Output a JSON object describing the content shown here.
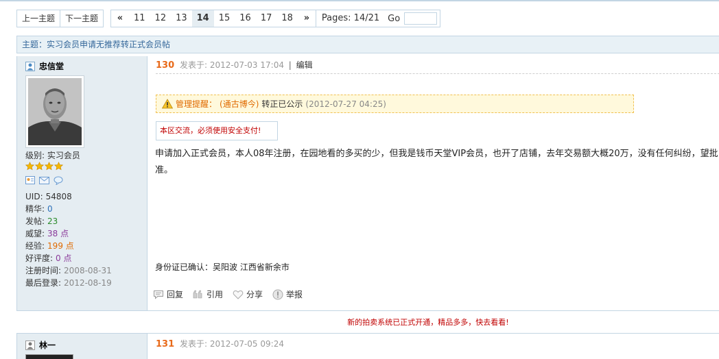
{
  "nav": {
    "prev_topic": "上一主题",
    "next_topic": "下一主题"
  },
  "pager": {
    "prev": "«",
    "pages": [
      "11",
      "12",
      "13",
      "14",
      "15",
      "16",
      "17",
      "18"
    ],
    "current": "14",
    "next": "»",
    "info": "Pages: 14/21",
    "go_label": "Go",
    "go_value": ""
  },
  "topic": {
    "title": "主题：实习会员申请无推荐转正式会员帖"
  },
  "post": {
    "author": "忠信堂",
    "level": "级别: 实习会员",
    "stars": 4,
    "stats": [
      {
        "label": "UID:",
        "value": "54808",
        "color": "#333333"
      },
      {
        "label": "精华:",
        "value": "0",
        "color": "#2b6fb8"
      },
      {
        "label": "发帖:",
        "value": "23",
        "color": "#2a8a2a"
      },
      {
        "label": "威望:",
        "value": "38 点",
        "color": "#8a3a9a"
      },
      {
        "label": "经验:",
        "value": "199 点",
        "color": "#e06a00"
      },
      {
        "label": "好评度:",
        "value": "0 点",
        "color": "#8a3a9a"
      },
      {
        "label": "注册时间:",
        "value": "2008-08-31",
        "color": "#888888"
      },
      {
        "label": "最后登录:",
        "value": "2012-08-19",
        "color": "#888888"
      }
    ],
    "floor": "130",
    "posted_label": "发表于: 2012-07-03 17:04",
    "sep": "|",
    "edit": "编辑",
    "notice": {
      "label": "管理提醒：",
      "who": "(通古博今)",
      "action": "转正已公示",
      "time": "(2012-07-27 04:25)"
    },
    "warning": "本区交流，必须使用安全支付!",
    "content": "申请加入正式会员，本人08年注册，在园地看的多买的少，但我是钱币天堂VIP会员，也开了店铺，去年交易额大概20万，没有任何纠纷，望批准。",
    "id_confirm": "身份证已确认：吴阳波 江西省新余市",
    "actions": {
      "reply": "回复",
      "quote": "引用",
      "share": "分享",
      "report": "举报"
    }
  },
  "ad": {
    "text": "新的拍卖系统已正式开通，精品多多，快去看看!"
  },
  "post2": {
    "author": "林一",
    "floor": "131",
    "posted_label": "发表于: 2012-07-05 09:24"
  },
  "colors": {
    "border": "#c2d5e3",
    "side_bg": "#e5edf2",
    "topic_bg": "#e8f1f6",
    "floor_orange": "#e86a1a",
    "warn_red": "#c00000",
    "notice_bg": "#fff9dc"
  },
  "icons": {
    "user": "user-icon",
    "star": "star-icon",
    "profile": "profile-card-icon",
    "mail": "mail-icon",
    "chat": "chat-bubble-icon",
    "warning": "warning-triangle-icon",
    "reply": "reply-icon",
    "quote": "quote-icon",
    "share": "heart-share-icon",
    "report": "report-icon"
  }
}
